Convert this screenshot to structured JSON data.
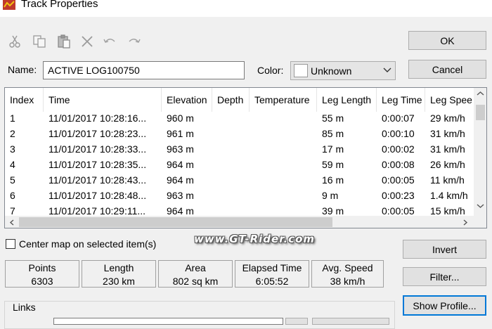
{
  "window": {
    "title": "Track Properties",
    "icon": "app-icon"
  },
  "toolbar": {
    "icons": [
      "cut-icon",
      "copy-icon",
      "paste-icon",
      "delete-icon",
      "undo-icon",
      "redo-icon"
    ]
  },
  "buttons": {
    "ok": "OK",
    "cancel": "Cancel",
    "invert": "Invert",
    "filter": "Filter...",
    "show_profile": "Show Profile..."
  },
  "name_field": {
    "label": "Name:",
    "value": "ACTIVE LOG100750"
  },
  "color_field": {
    "label": "Color:",
    "value": "Unknown",
    "swatch": "#ffffff"
  },
  "table": {
    "columns": [
      "Index",
      "Time",
      "Elevation",
      "Depth",
      "Temperature",
      "Leg Length",
      "Leg Time",
      "Leg Spee"
    ],
    "rows": [
      [
        "1",
        "11/01/2017 10:28:16...",
        "960 m",
        "",
        "",
        "55 m",
        "0:00:07",
        "29 km/h"
      ],
      [
        "2",
        "11/01/2017 10:28:23...",
        "961 m",
        "",
        "",
        "85 m",
        "0:00:10",
        "31 km/h"
      ],
      [
        "3",
        "11/01/2017 10:28:33...",
        "963 m",
        "",
        "",
        "17 m",
        "0:00:02",
        "31 km/h"
      ],
      [
        "4",
        "11/01/2017 10:28:35...",
        "964 m",
        "",
        "",
        "59 m",
        "0:00:08",
        "26 km/h"
      ],
      [
        "5",
        "11/01/2017 10:28:43...",
        "964 m",
        "",
        "",
        "16 m",
        "0:00:05",
        "11 km/h"
      ],
      [
        "6",
        "11/01/2017 10:28:48...",
        "963 m",
        "",
        "",
        "9 m",
        "0:00:23",
        "1.4 km/h"
      ],
      [
        "7",
        "11/01/2017 10:29:11...",
        "964 m",
        "",
        "",
        "39 m",
        "0:00:05",
        "15 km/h"
      ]
    ]
  },
  "checkbox": {
    "label": "Center map on selected item(s)",
    "checked": false
  },
  "watermark": "www.GT-Rider.com",
  "stats": [
    {
      "label": "Points",
      "value": "6303"
    },
    {
      "label": "Length",
      "value": "230 km"
    },
    {
      "label": "Area",
      "value": "802 sq km"
    },
    {
      "label": "Elapsed Time",
      "value": "6:05:52"
    },
    {
      "label": "Avg. Speed",
      "value": "38 km/h"
    }
  ],
  "links": {
    "label": "Links"
  },
  "colors": {
    "focus_border": "#0078d7",
    "window_bg": "#f0f0f0"
  }
}
